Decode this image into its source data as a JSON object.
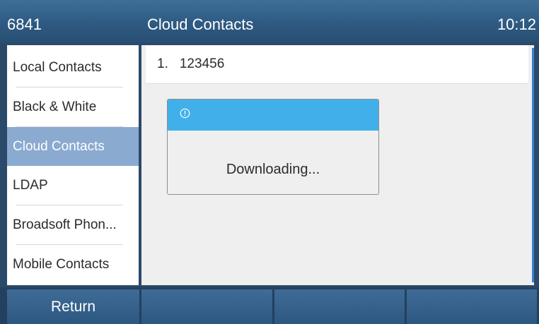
{
  "status_bar": {
    "extension": "6841",
    "title": "Cloud Contacts",
    "time": "10:12"
  },
  "sidebar": {
    "items": [
      {
        "label": "Local Contacts"
      },
      {
        "label": "Black & White"
      },
      {
        "label": "Cloud Contacts"
      },
      {
        "label": "LDAP"
      },
      {
        "label": "Broadsoft Phon..."
      },
      {
        "label": "Mobile Contacts"
      }
    ],
    "selected": "Cloud Contacts"
  },
  "list": {
    "rows": [
      {
        "index": "1.",
        "value": "123456"
      }
    ]
  },
  "dialog": {
    "icon": "info-icon",
    "message": "Downloading..."
  },
  "softkeys": {
    "labels": [
      "Return",
      "",
      "",
      ""
    ]
  },
  "colors": {
    "title_bar": "#2e5a82",
    "selected_item": "#8aaad0",
    "dialog_header": "#41b0ea",
    "scrollbar": "#3b7fd3"
  }
}
